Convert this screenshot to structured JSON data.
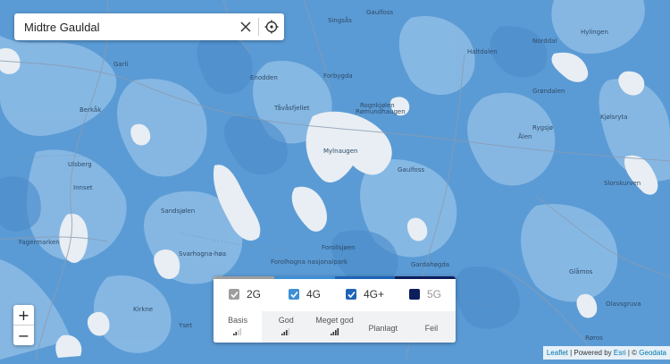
{
  "search": {
    "value": "Midtre Gauldal"
  },
  "legend": {
    "networks": [
      {
        "label": "2G",
        "checked": true,
        "color": "#9e9e9e",
        "text_color": "#333333"
      },
      {
        "label": "4G",
        "checked": true,
        "color": "#3d8fd6",
        "text_color": "#333333"
      },
      {
        "label": "4G+",
        "checked": true,
        "color": "#1d64b6",
        "text_color": "#333333"
      },
      {
        "label": "5G",
        "checked": false,
        "color": "#0d1e5c",
        "text_color": "#999999"
      }
    ],
    "quality": [
      {
        "label": "Basis",
        "bars": 2,
        "active": true
      },
      {
        "label": "God",
        "bars": 3,
        "active": false
      },
      {
        "label": "Meget god",
        "bars": 4,
        "active": false
      },
      {
        "label": "Planlagt",
        "bars": 0,
        "active": false
      },
      {
        "label": "Feil",
        "bars": 0,
        "active": false
      }
    ]
  },
  "zoom": {
    "in_label": "+",
    "out_label": "−"
  },
  "attribution": {
    "leaflet": "Leaflet",
    "sep1": " | Powered by ",
    "esri": "Esri",
    "sep2": " | © ",
    "geodata": "Geodata"
  },
  "map_labels": [
    "Singsås",
    "Gaulfoss",
    "Hylingen",
    "Norddal",
    "Haltdalen",
    "Garli",
    "Enodden",
    "Forbygda",
    "Berkåk",
    "Tåvåsfjellet",
    "Rognkjølen",
    "Kjølsryta",
    "Grøndalen",
    "Rømundhaugen",
    "Ålen",
    "Rygsjø",
    "Mylnaugen",
    "Gaulfoss",
    "Ulsberg",
    "Innset",
    "Slorskurven",
    "Sandsjølen",
    "Fagermarken",
    "Svarhogna-høa",
    "Forolhogna nasjonalpark",
    "Forollsjøen",
    "Gardahøgda",
    "Glåmos",
    "Kirkne",
    "Olavsgruva",
    "Yset",
    "Røros"
  ],
  "colors": {
    "map_base": "#5b9bd5",
    "map_light": "#8ebde6",
    "map_mid": "#4a8bca",
    "map_white": "#e8eef3",
    "map_road": "#8a9bb0",
    "legend_active_bg": "#ffffff",
    "legend_inactive_bg": "#f0f2f4"
  }
}
